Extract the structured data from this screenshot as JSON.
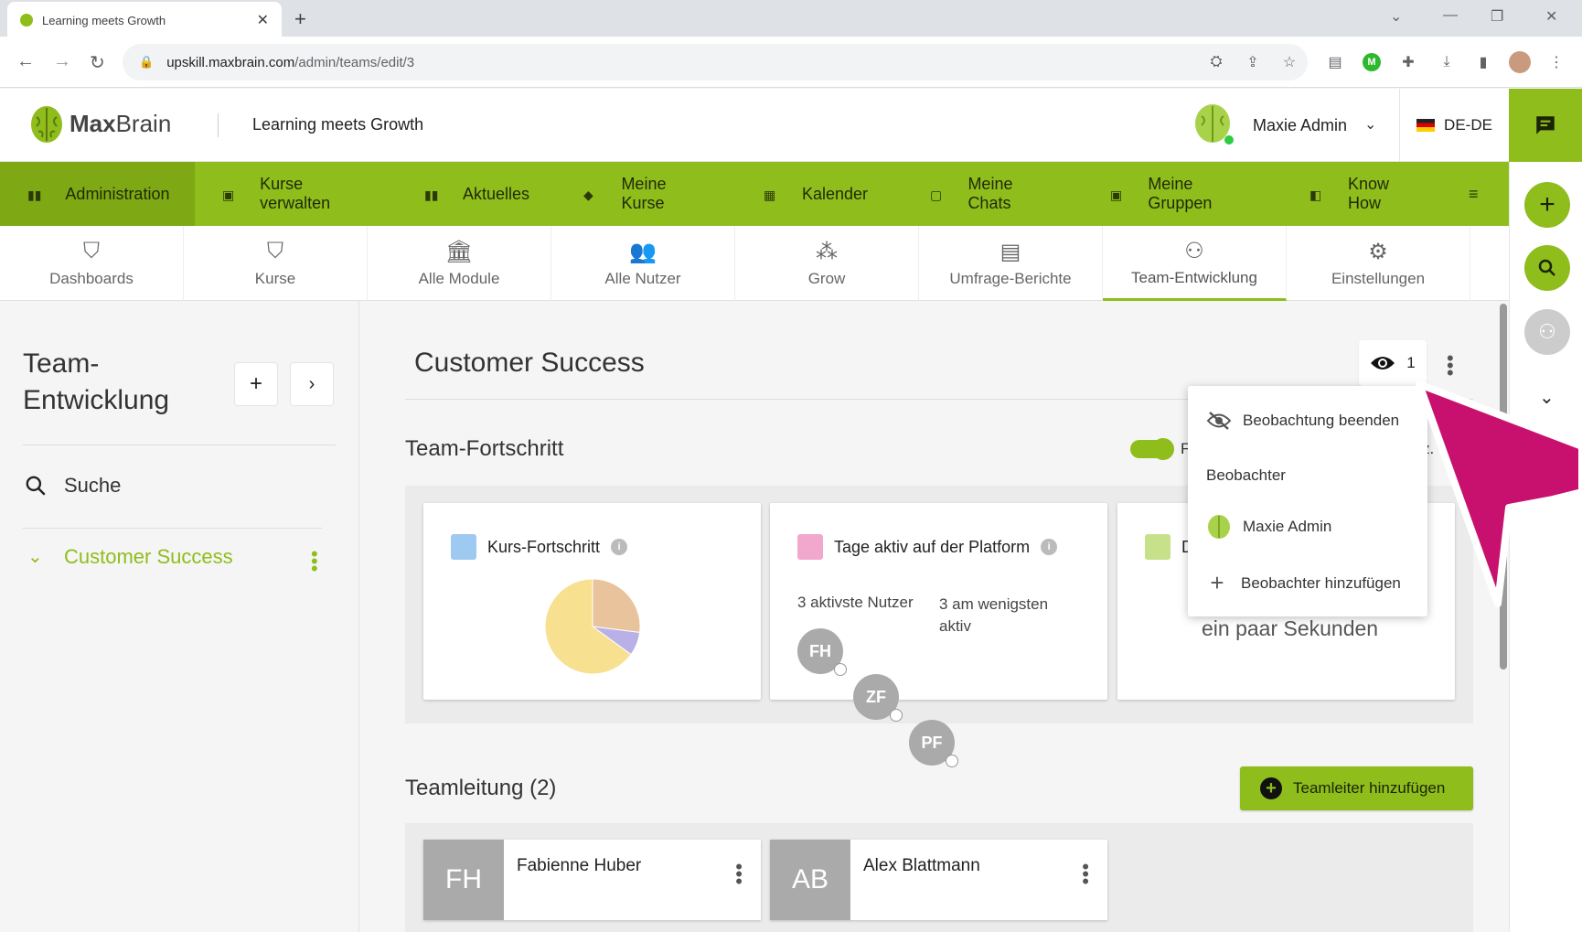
{
  "browser": {
    "tab_title": "Learning meets Growth",
    "tab_close": "✕",
    "new_tab": "+",
    "url_host": "upskill.maxbrain.com",
    "url_path": "/admin/teams/edit/3"
  },
  "header": {
    "logo_bold": "Max",
    "logo_light": "Brain",
    "title": "Learning meets Growth",
    "user_name": "Maxie Admin",
    "language": "DE-DE"
  },
  "main_nav": [
    {
      "label": "Administration",
      "icon": "book-icon"
    },
    {
      "label": "Kurse verwalten",
      "icon": "id-card-icon"
    },
    {
      "label": "Aktuelles",
      "icon": "book-icon"
    },
    {
      "label": "Meine Kurse",
      "icon": "graduation-cap-icon"
    },
    {
      "label": "Kalender",
      "icon": "calendar-icon"
    },
    {
      "label": "Meine Chats",
      "icon": "chat-icon"
    },
    {
      "label": "Meine Gruppen",
      "icon": "id-card-icon"
    },
    {
      "label": "Know How",
      "icon": "book-open-icon"
    }
  ],
  "sub_nav": [
    {
      "label": "Dashboards"
    },
    {
      "label": "Kurse"
    },
    {
      "label": "Alle Module"
    },
    {
      "label": "Alle Nutzer"
    },
    {
      "label": "Grow"
    },
    {
      "label": "Umfrage-Berichte"
    },
    {
      "label": "Team-Entwicklung"
    },
    {
      "label": "Einstellungen"
    }
  ],
  "sidebar": {
    "title": "Team-\nEntwicklung",
    "search_label": "Suche",
    "team_item": "Customer Success"
  },
  "main": {
    "title": "Customer Success",
    "observer_count": "1",
    "progress_section": "Team-Fortschritt",
    "toggle_label_partial_left": "F",
    "toggle_label_partial_right": "z."
  },
  "cards": {
    "course_progress": {
      "title": "Kurs-Fortschritt",
      "info": "i"
    },
    "active_days": {
      "title": "Tage aktiv auf der Platform",
      "info": "i",
      "most_active_label": "3 aktivste Nutzer",
      "least_active_label": "3 am wenigsten aktiv",
      "avatars": [
        "FH",
        "ZF",
        "PF"
      ]
    },
    "last_activity": {
      "title_partial": "D",
      "value": "ein paar Sekunden"
    }
  },
  "popup": {
    "stop_observing": "Beobachtung beenden",
    "observers_heading": "Beobachter",
    "observer_name": "Maxie Admin",
    "add_observer": "Beobachter hinzufügen"
  },
  "leads": {
    "heading": "Teamleitung (2)",
    "add_button": "Teamleiter hinzufügen",
    "items": [
      {
        "initials": "FH",
        "name": "Fabienne Huber"
      },
      {
        "initials": "AB",
        "name": "Alex Blattmann"
      }
    ]
  },
  "chart_data": {
    "type": "pie",
    "values": [
      27,
      8,
      65
    ],
    "colors": [
      "#e8c39c",
      "#b8b0e6",
      "#f7e08f"
    ]
  },
  "colors": {
    "brand": "#8fbd1c",
    "arrow": "#c8106e"
  }
}
